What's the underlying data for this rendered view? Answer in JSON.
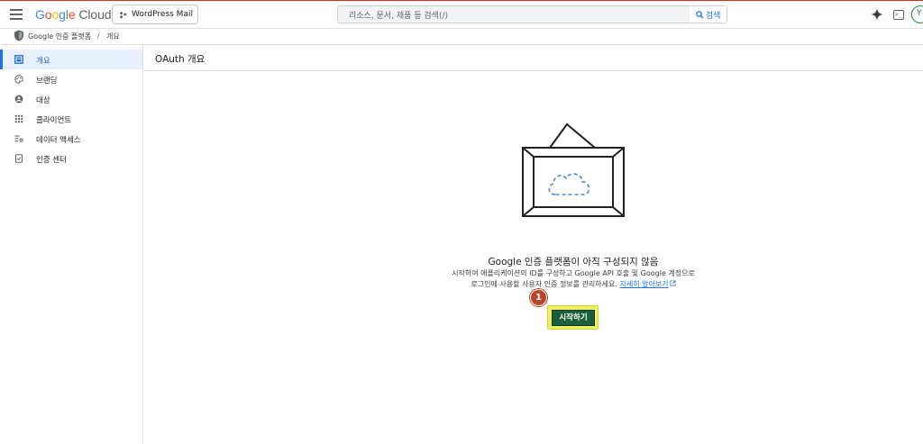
{
  "header": {
    "logo_parts": [
      "G",
      "o",
      "o",
      "g",
      "l",
      "e"
    ],
    "logo_product": "Cloud",
    "project_name": "WordPress Mail",
    "search_placeholder": "리소스, 문서, 제품 등 검색(/)",
    "search_button_label": "검색",
    "terminal_label": ">_",
    "avatar_initial": "Y"
  },
  "breadcrumb": {
    "items": [
      "Google 인증 플랫폼",
      "개요"
    ],
    "separator": "/"
  },
  "sidebar": {
    "items": [
      {
        "label": "개요",
        "icon": "dashboard-icon",
        "active": true
      },
      {
        "label": "브랜딩",
        "icon": "palette-icon",
        "active": false
      },
      {
        "label": "대상",
        "icon": "person-icon",
        "active": false
      },
      {
        "label": "클라이언트",
        "icon": "grid-dots-icon",
        "active": false
      },
      {
        "label": "데이터 액세스",
        "icon": "list-settings-icon",
        "active": false
      },
      {
        "label": "인증 센터",
        "icon": "verified-document-icon",
        "active": false
      }
    ]
  },
  "main": {
    "title": "OAuth 개요",
    "empty_title": "Google 인증 플랫폼이 아직 구성되지 않음",
    "empty_desc_line1": "시작하여 애플리케이션의 ID를 구성하고 Google API 호출 및 Google 계정으로",
    "empty_desc_line2": "로그인에 사용할 사용자 인증 정보를 관리하세요.",
    "learn_more": "자세히 알아보기",
    "start_button": "시작하기",
    "step_badge": "1"
  },
  "colors": {
    "accent": "#1a73e8",
    "start_button_bg": "#1b5e3b",
    "highlight": "#f2ef63",
    "badge": "#b7472a"
  }
}
